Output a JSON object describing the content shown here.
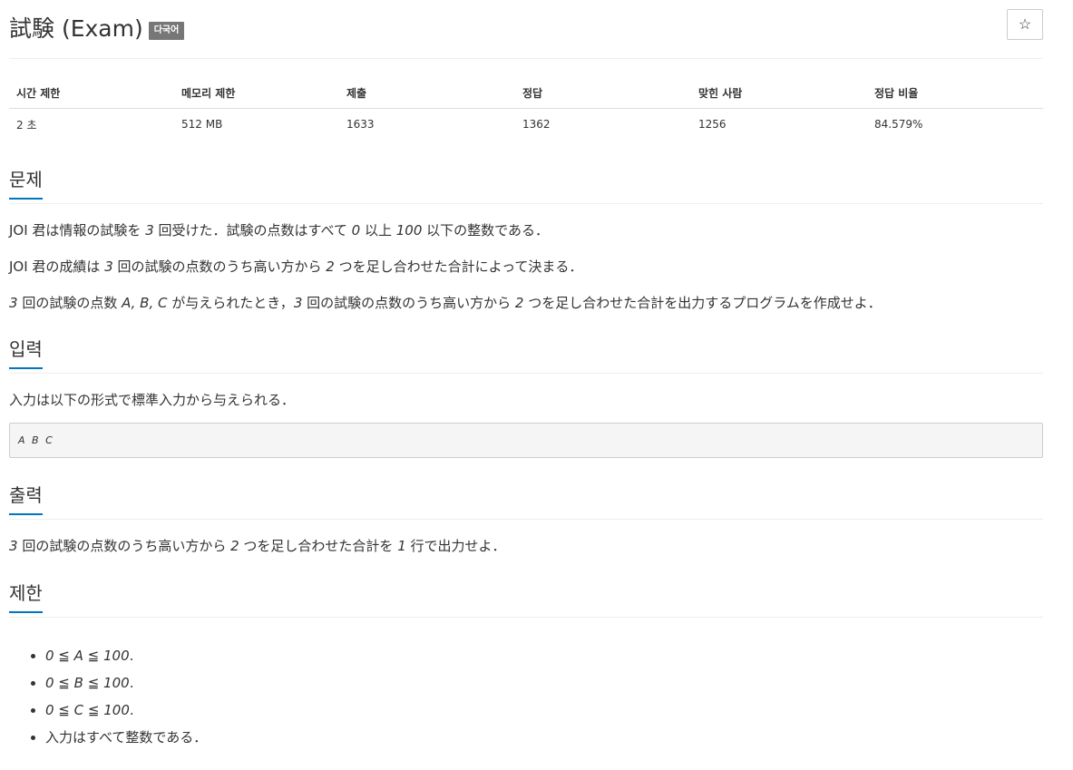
{
  "problem": {
    "title": "試験 (Exam)",
    "lang_badge": "다국어",
    "star_icon": "☆"
  },
  "info_table": {
    "headers": [
      "시간 제한",
      "메모리 제한",
      "제출",
      "정답",
      "맞힌 사람",
      "정답 비율"
    ],
    "values": [
      "2 초",
      "512 MB",
      "1633",
      "1362",
      "1256",
      "84.579%"
    ]
  },
  "sections": {
    "problem_label": "문제",
    "input_label": "입력",
    "output_label": "출력",
    "limits_label": "제한"
  },
  "statement": {
    "p1": [
      "JOI 君は情報の試験を ",
      "3",
      " 回受けた．試験の点数はすべて ",
      "0",
      " 以上 ",
      "100",
      " 以下の整数である．"
    ],
    "p2": [
      "JOI 君の成績は ",
      "3",
      " 回の試験の点数のうち高い方から ",
      "2",
      " つを足し合わせた合計によって決まる．"
    ],
    "p3": [
      "3",
      " 回の試験の点数 ",
      "A, B, C",
      " が与えられたとき，",
      "3",
      " 回の試験の点数のうち高い方から ",
      "2",
      " つを足し合わせた合計を出力するプログラムを作成せよ．"
    ]
  },
  "input": {
    "text": "入力は以下の形式で標準入力から与えられる．",
    "format": "A B C"
  },
  "output": {
    "parts": [
      "3",
      " 回の試験の点数のうち高い方から ",
      "2",
      " つを足し合わせた合計を ",
      "1",
      " 行で出力せよ．"
    ]
  },
  "limits": {
    "items": [
      [
        "0 ≦ A ≦ 100",
        "."
      ],
      [
        "0 ≦ B ≦ 100",
        "."
      ],
      [
        "0 ≦ C ≦ 100",
        "."
      ],
      [
        "",
        "入力はすべて整数である．"
      ]
    ]
  }
}
